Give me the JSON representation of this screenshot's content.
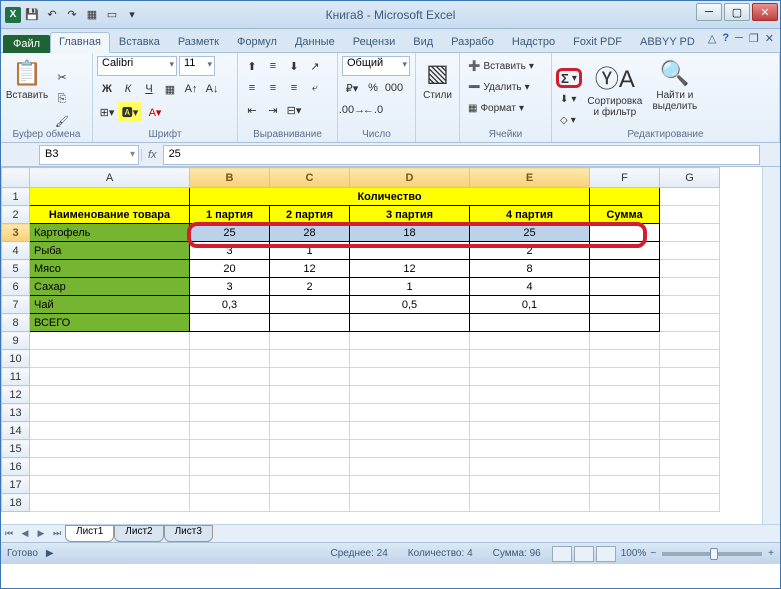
{
  "window": {
    "title": "Книга8 - Microsoft Excel"
  },
  "qat": {
    "save": "💾",
    "undo": "↶",
    "redo": "↷",
    "new": "▦",
    "open": "▭"
  },
  "tabs": {
    "file": "Файл",
    "items": [
      "Главная",
      "Вставка",
      "Разметк",
      "Формул",
      "Данные",
      "Рецензи",
      "Вид",
      "Разрабо",
      "Надстро",
      "Foxit PDF",
      "ABBYY PD"
    ],
    "active": 0
  },
  "ribbon": {
    "clipboard": {
      "label": "Буфер обмена",
      "paste": "Вставить"
    },
    "font": {
      "label": "Шрифт",
      "name": "Calibri",
      "size": "11",
      "bold": "Ж",
      "italic": "К",
      "underline": "Ч"
    },
    "align": {
      "label": "Выравнивание"
    },
    "number": {
      "label": "Число",
      "format": "Общий"
    },
    "styles": {
      "label": "",
      "btn": "Стили"
    },
    "cells": {
      "label": "Ячейки",
      "insert": "Вставить",
      "delete": "Удалить",
      "format": "Формат"
    },
    "editing": {
      "label": "Редактирование",
      "autosum": "Σ",
      "fill": "⬇",
      "clear": "◇",
      "sort": "Сортировка и фильтр",
      "find": "Найти и выделить"
    }
  },
  "formula": {
    "cell_ref": "B3",
    "fx": "fx",
    "value": "25"
  },
  "columns": [
    "A",
    "B",
    "C",
    "D",
    "E",
    "F",
    "G"
  ],
  "sel_cols": [
    "B",
    "C",
    "D",
    "E"
  ],
  "rows": [
    1,
    2,
    3,
    4,
    5,
    6,
    7,
    8,
    9,
    10,
    11,
    12,
    13,
    14,
    15,
    16,
    17,
    18
  ],
  "sel_row": 3,
  "table": {
    "qty_header": "Количество",
    "name_header": "Наименование товара",
    "batch": [
      "1 партия",
      "2 партия",
      "3 партия",
      "4 партия"
    ],
    "sum_header": "Сумма",
    "rows": [
      {
        "name": "Картофель",
        "v": [
          "25",
          "28",
          "18",
          "25"
        ]
      },
      {
        "name": "Рыба",
        "v": [
          "3",
          "1",
          "",
          "2"
        ]
      },
      {
        "name": "Мясо",
        "v": [
          "20",
          "12",
          "12",
          "8"
        ]
      },
      {
        "name": "Сахар",
        "v": [
          "3",
          "2",
          "1",
          "4"
        ]
      },
      {
        "name": "Чай",
        "v": [
          "0,3",
          "",
          "0,5",
          "0,1"
        ]
      },
      {
        "name": "ВСЕГО",
        "v": [
          "",
          "",
          "",
          ""
        ]
      }
    ]
  },
  "sheets": [
    "Лист1",
    "Лист2",
    "Лист3"
  ],
  "status": {
    "ready": "Готово",
    "avg_lbl": "Среднее:",
    "avg": "24",
    "count_lbl": "Количество:",
    "count": "4",
    "sum_lbl": "Сумма:",
    "sum": "96",
    "zoom": "100%"
  },
  "chart_data": {
    "type": "table",
    "title": "Количество",
    "columns": [
      "Наименование товара",
      "1 партия",
      "2 партия",
      "3 партия",
      "4 партия",
      "Сумма"
    ],
    "rows": [
      [
        "Картофель",
        25,
        28,
        18,
        25,
        null
      ],
      [
        "Рыба",
        3,
        1,
        null,
        2,
        null
      ],
      [
        "Мясо",
        20,
        12,
        12,
        8,
        null
      ],
      [
        "Сахар",
        3,
        2,
        1,
        4,
        null
      ],
      [
        "Чай",
        0.3,
        null,
        0.5,
        0.1,
        null
      ],
      [
        "ВСЕГО",
        null,
        null,
        null,
        null,
        null
      ]
    ]
  }
}
